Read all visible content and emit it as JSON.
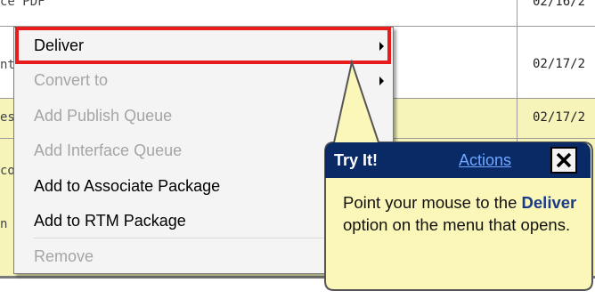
{
  "table": {
    "top_fragment": "ce_PDF",
    "rows": [
      {
        "left_fragment": "nt",
        "date": "02/17/2"
      },
      {
        "left_fragment": "es",
        "date": "02/17/2"
      },
      {
        "left_fragment": "co",
        "date": ""
      },
      {
        "left_fragment": "n",
        "date": ""
      }
    ],
    "top_date": "02/16/2"
  },
  "context_menu": {
    "items": [
      {
        "label": "Deliver",
        "enabled": true,
        "submenu": true,
        "highlighted": true
      },
      {
        "label": "Convert to",
        "enabled": false,
        "submenu": true
      },
      {
        "label": "Add Publish Queue",
        "enabled": false,
        "submenu": false
      },
      {
        "label": "Add Interface Queue",
        "enabled": false,
        "submenu": false
      },
      {
        "label": "Add to Associate Package",
        "enabled": true,
        "submenu": false
      },
      {
        "label": "Add to RTM Package",
        "enabled": true,
        "submenu": false
      },
      {
        "label": "Remove",
        "enabled": false,
        "submenu": false
      }
    ]
  },
  "callout": {
    "title": "Try It!",
    "actions_label": "Actions",
    "body_prefix": "Point your mouse to the ",
    "body_emphasis": "Deliver",
    "body_suffix": " option on the menu that opens."
  },
  "colors": {
    "row_yellow": "#f6f4b9",
    "highlight": "#e81c1c",
    "callout_header": "#0a2a66",
    "callout_body": "#fbf7b8",
    "link": "#6fa8ff"
  }
}
